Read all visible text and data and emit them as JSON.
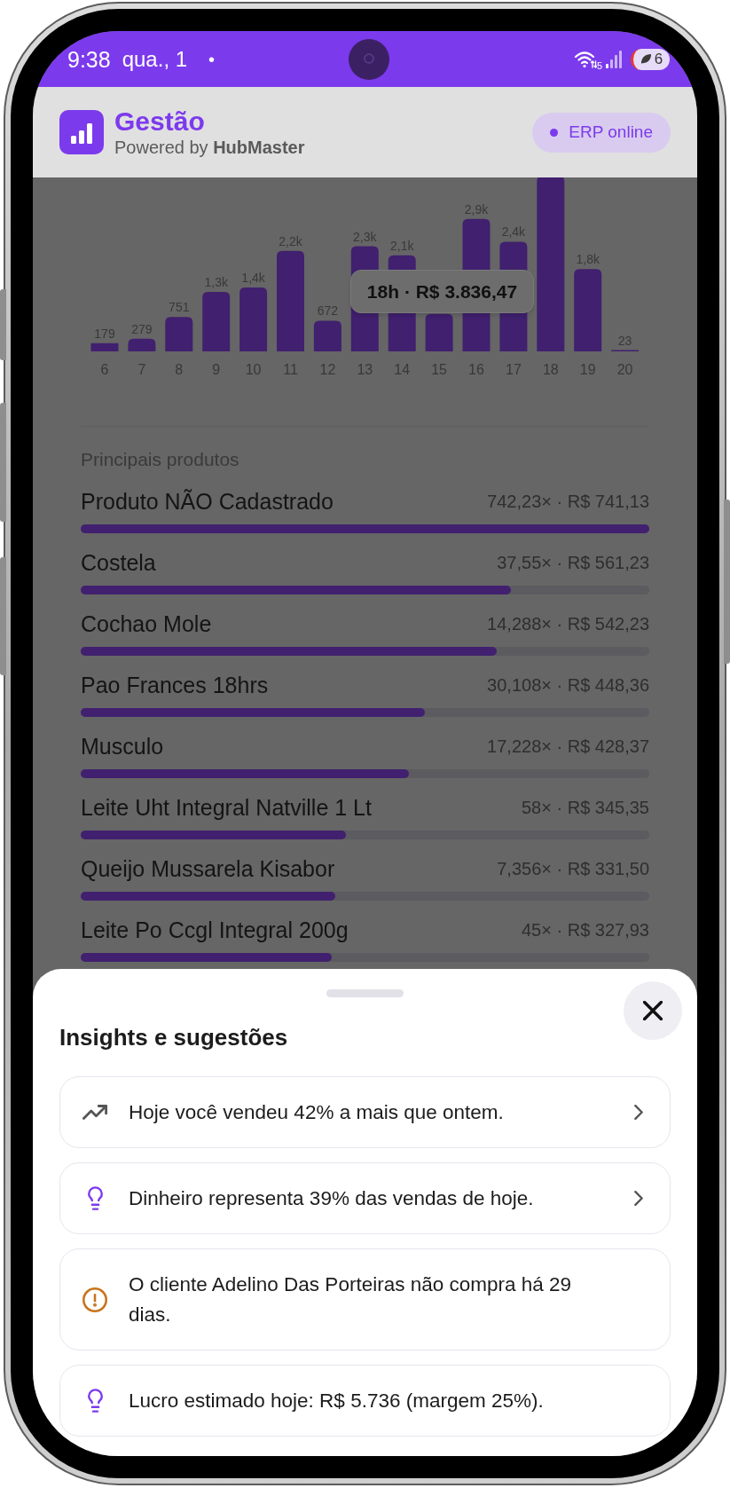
{
  "status_bar": {
    "time": "9:38",
    "date": "qua., 1",
    "notification_dot": "•",
    "network_type": "5",
    "battery_level": "6"
  },
  "header": {
    "title": "Gestão",
    "subtitle": "Powered by **HubMaster**",
    "badge": "ERP online"
  },
  "chart": {
    "tooltip": "18h · R$ 3.836,47",
    "chart_data": {
      "type": "bar",
      "categories": [
        "6",
        "7",
        "8",
        "9",
        "10",
        "11",
        "12",
        "13",
        "14",
        "15",
        "16",
        "17",
        "18",
        "19",
        "20"
      ],
      "values": [
        179,
        279,
        751,
        1300,
        1400,
        2200,
        672,
        2300,
        2100,
        820,
        2900,
        2400,
        3836.47,
        1800,
        23
      ],
      "value_labels": [
        "179",
        "279",
        "751",
        "1,3k",
        "1,4k",
        "2,2k",
        "672",
        "2,3k",
        "2,1k",
        null,
        "2,9k",
        "2,4k",
        null,
        "1,8k",
        "23"
      ]
    }
  },
  "products": {
    "title": "Principais produtos",
    "items": [
      {
        "name": "Produto NÃO Cadastrado",
        "summary": "742,23× · R$ 741,13",
        "level": 1.0
      },
      {
        "name": "Costela",
        "summary": "37,55× · R$ 561,23",
        "level": 0.757
      },
      {
        "name": "Cochao Mole",
        "summary": "14,288× · R$ 542,23",
        "level": 0.732
      },
      {
        "name": "Pao Frances 18hrs",
        "summary": "30,108× · R$ 448,36",
        "level": 0.605
      },
      {
        "name": "Musculo",
        "summary": "17,228× · R$ 428,37",
        "level": 0.578
      },
      {
        "name": "Leite Uht Integral Natville 1 Lt",
        "summary": "58× · R$ 345,35",
        "level": 0.466
      },
      {
        "name": "Queijo Mussarela Kisabor",
        "summary": "7,356× · R$ 331,50",
        "level": 0.447
      },
      {
        "name": "Leite Po Ccgl Integral 200g",
        "summary": "45× · R$ 327,93",
        "level": 0.442
      }
    ]
  },
  "insights_sheet": {
    "title": "Insights e sugestões",
    "items": [
      {
        "kind": "trend",
        "text": "Hoje você vendeu 42% a mais que ontem.",
        "chevron": true
      },
      {
        "kind": "tip",
        "text": "Dinheiro representa 39% das vendas de hoje.",
        "chevron": true
      },
      {
        "kind": "alert",
        "text": "O cliente Adelino Das Porteiras não compra há 29 dias.",
        "chevron": false
      },
      {
        "kind": "tip",
        "text": "Lucro estimado hoje: R$ 5.736 (margem 25%).",
        "chevron": false
      }
    ]
  }
}
